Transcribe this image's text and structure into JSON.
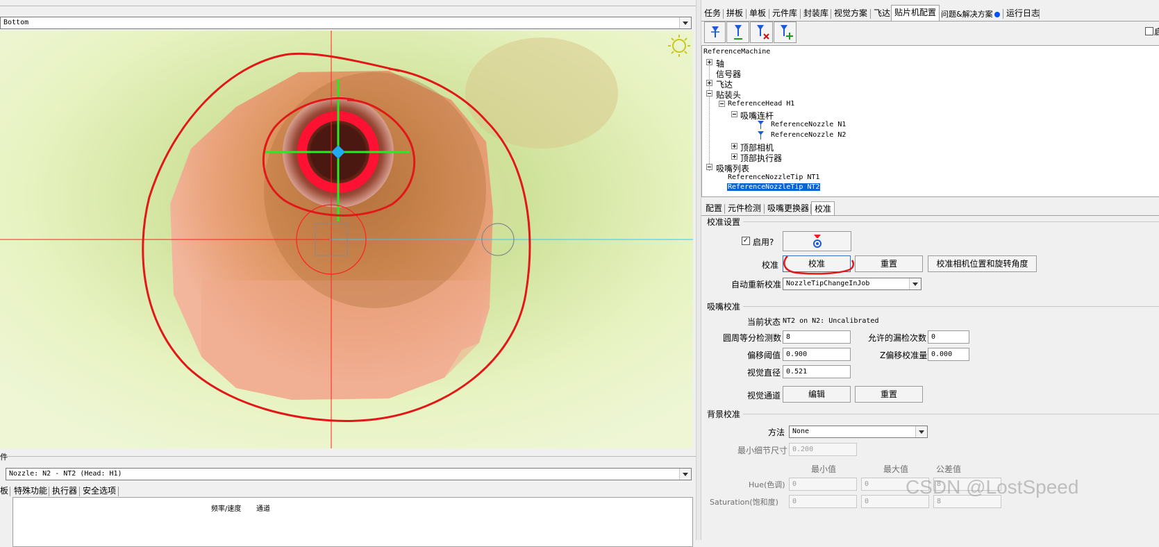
{
  "camera": {
    "view_select": "Bottom",
    "nozzle_select": "Nozzle: N2 - NT2 (Head: H1)"
  },
  "bottom_tabs": [
    "板",
    "特殊功能",
    "执行器",
    "安全选项"
  ],
  "bottom_table_headers": [
    "频率/速度",
    "通道"
  ],
  "left_edge_char": "件",
  "main_tabs": [
    "任务",
    "拼板",
    "单板",
    "元件库",
    "封装库",
    "视觉方案",
    "飞达",
    "贴片机配置",
    "问题&解决方案",
    "运行日志"
  ],
  "toolbar_icons": [
    "nozzle-icon",
    "nozzle-load-icon",
    "nozzle-delete-icon",
    "nozzle-add-icon"
  ],
  "tree": {
    "root": "ReferenceMachine",
    "items": [
      {
        "label": "轴",
        "level": 1
      },
      {
        "label": "信号器",
        "level": 1
      },
      {
        "label": "飞达",
        "level": 1
      },
      {
        "label": "贴装头",
        "level": 1
      },
      {
        "label": "ReferenceHead H1",
        "level": 2
      },
      {
        "label": "吸嘴连杆",
        "level": 3
      },
      {
        "label": "ReferenceNozzle N1",
        "level": 4
      },
      {
        "label": "ReferenceNozzle N2",
        "level": 4
      },
      {
        "label": "顶部相机",
        "level": 3
      },
      {
        "label": "顶部执行器",
        "level": 3
      },
      {
        "label": "吸嘴列表",
        "level": 1
      },
      {
        "label": "ReferenceNozzleTip NT1",
        "level": 2
      },
      {
        "label": "ReferenceNozzleTip NT2",
        "level": 2,
        "selected": true
      }
    ]
  },
  "sub_tabs": [
    "配置",
    "元件检测",
    "吸嘴更换器",
    "校准"
  ],
  "calib_settings": {
    "title": "校准设置",
    "enable_label": "启用?",
    "calib_label": "校准",
    "calib_btn": "校准",
    "reset_btn": "重置",
    "camera_calib_btn": "校准相机位置和旋转角度",
    "auto_recalib_label": "自动重新校准",
    "auto_recalib_value": "NozzleTipChangeInJob"
  },
  "nozzle_calib": {
    "title": "吸嘴校准",
    "status_label": "当前状态",
    "status_value": "NT2 on N2: Uncalibrated",
    "circle_label": "圆周等分检测数",
    "circle_value": "8",
    "miss_label": "允许的漏检次数",
    "miss_value": "0",
    "offset_label": "偏移阈值",
    "offset_value": "0.900",
    "z_label": "Z偏移校准量",
    "z_value": "0.000",
    "diameter_label": "视觉直径",
    "diameter_value": "0.521",
    "pipeline_label": "视觉通道",
    "edit_btn": "编辑",
    "reset_btn": "重置"
  },
  "bg_calib": {
    "title": "背景校准",
    "method_label": "方法",
    "method_value": "None",
    "min_detail_label": "最小细节尺寸",
    "min_detail_value": "0.200",
    "col_min": "最小值",
    "col_max": "最大值",
    "col_tol": "公差值",
    "hue_label": "Hue(色调)",
    "hue_values": [
      "0",
      "0",
      "8"
    ],
    "sat_label": "Saturation(饱和度)",
    "sat_values": [
      "0",
      "0",
      "8"
    ]
  },
  "right_checkbox_label": "启",
  "watermark": "CSDN @LostSpeed"
}
